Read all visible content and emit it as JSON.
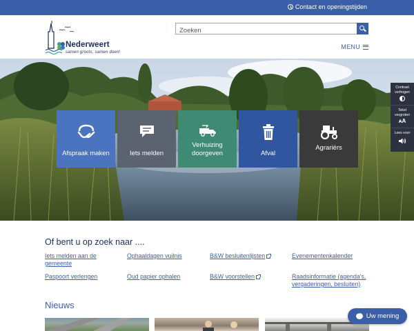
{
  "topbar": {
    "contact_label": "Contact en openingstijden",
    "bg_color": "#3a5fa8"
  },
  "header": {
    "logo_name": "Nederweert",
    "logo_tagline": "samen groots, samen doen!",
    "search_placeholder": "Zoeken",
    "menu_label": "MENU"
  },
  "hero": {
    "tiles": [
      {
        "label": "Afspraak maken",
        "icon": "handshake-icon",
        "color": "#4a74bf"
      },
      {
        "label": "Iets melden",
        "icon": "chat-icon",
        "color": "#5b6270"
      },
      {
        "label": "Verhuizing doorgeven",
        "icon": "moving-truck-icon",
        "color": "#3f8a72"
      },
      {
        "label": "Afval",
        "icon": "trash-icon",
        "color": "#2f569f"
      },
      {
        "label": "Agrariërs",
        "icon": "tractor-icon",
        "color": "#3a3a3a"
      }
    ]
  },
  "accessibility": {
    "items": [
      {
        "label": "Contrast verhogen",
        "icon": "contrast-icon"
      },
      {
        "label": "Tekst vergroten",
        "icon": "text-size-icon",
        "symbol": "ᴀA"
      },
      {
        "label": "Lees voor",
        "icon": "speaker-icon"
      }
    ]
  },
  "search_section": {
    "title": "Of bent u op zoek naar ....",
    "links": [
      {
        "label": "Iets melden aan de gemeente",
        "external": false
      },
      {
        "label": "Paspoort verlengen",
        "external": false
      },
      {
        "label": "Ophaaldagen vuilnis",
        "external": false
      },
      {
        "label": "Oud papier ophalen",
        "external": false
      },
      {
        "label": "B&W besluitenlijsten",
        "external": true
      },
      {
        "label": "B&W voorstellen",
        "external": true
      },
      {
        "label": "Evenementenkalender",
        "external": false
      },
      {
        "label": "Raadsinformatie (agenda's, vergaderingen, besluiten)",
        "external": false
      }
    ]
  },
  "news": {
    "title": "Nieuws"
  },
  "feedback": {
    "label": "Uw mening"
  }
}
